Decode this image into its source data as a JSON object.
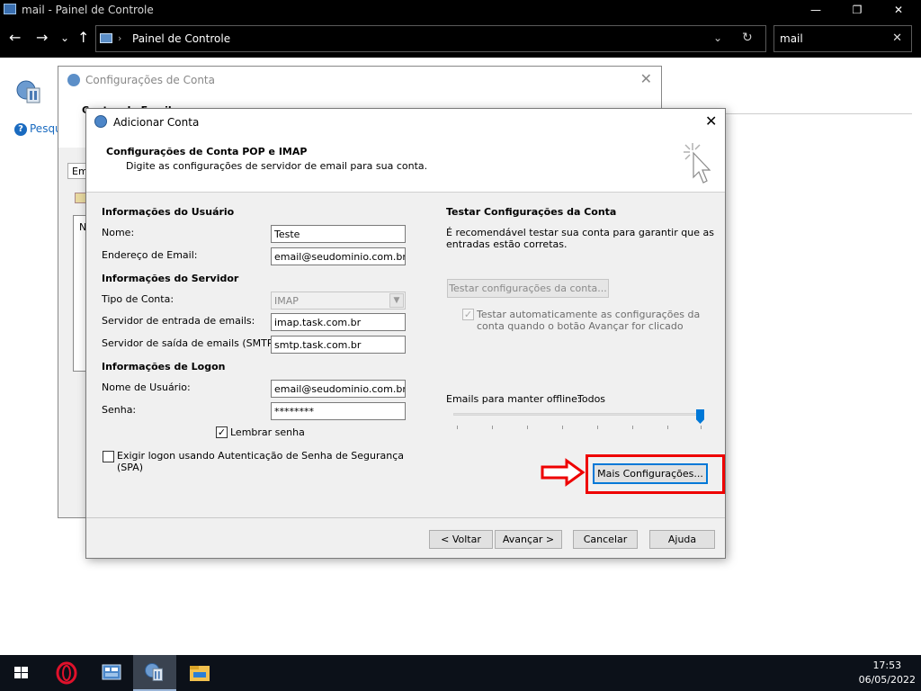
{
  "window": {
    "title": "mail - Painel de Controle",
    "minimize_glyph": "—",
    "maximize_glyph": "❐",
    "close_glyph": "✕"
  },
  "nav": {
    "back_glyph": "←",
    "forward_glyph": "→",
    "recent_glyph": "⌄",
    "up_glyph": "↑",
    "breadcrumb_sep": "›",
    "breadcrumb": "Painel de Controle",
    "address_dropdown_glyph": "⌄",
    "refresh_glyph": "↻",
    "search_value": "mail",
    "search_clear_glyph": "✕"
  },
  "background": {
    "help_glyph": "?",
    "help_text": "Pesqu",
    "config_dialog": {
      "title": "Configurações de Conta",
      "close_glyph": "✕",
      "subtitle": "Contas de Email",
      "tab_label": "Ema",
      "list_letter": "N"
    }
  },
  "dialog": {
    "title": "Adicionar Conta",
    "close_glyph": "✕",
    "header_title": "Configurações de Conta POP e IMAP",
    "header_desc": "Digite as configurações de servidor de email para sua conta.",
    "user_info": {
      "heading": "Informações do Usuário",
      "name_label": "Nome:",
      "name_value": "Teste",
      "email_label": "Endereço de Email:",
      "email_value": "email@seudominio.com.br"
    },
    "server_info": {
      "heading": "Informações do Servidor",
      "account_type_label": "Tipo de Conta:",
      "account_type_value": "IMAP",
      "incoming_label": "Servidor de entrada de emails:",
      "incoming_value": "imap.task.com.br",
      "outgoing_label": "Servidor de saída de emails (SMTP):",
      "outgoing_value": "smtp.task.com.br"
    },
    "logon_info": {
      "heading": "Informações de Logon",
      "username_label": "Nome de Usuário:",
      "username_value": "email@seudominio.com.br",
      "password_label": "Senha:",
      "password_value": "********",
      "remember_label": "Lembrar senha",
      "remember_checked": true,
      "spa_label_line1": "Exigir logon usando Autenticação de Senha de Segurança",
      "spa_label_line2": "(SPA)",
      "spa_checked": false
    },
    "test_settings": {
      "heading": "Testar Configurações da Conta",
      "desc_line1": "É recomendável testar sua conta para garantir que as",
      "desc_line2": "entradas estão corretas.",
      "test_button": "Testar configurações da conta...",
      "auto_test_label_line1": "Testar automaticamente as configurações da",
      "auto_test_label_line2": "conta quando o botão Avançar for clicado",
      "auto_test_checked": true
    },
    "offline": {
      "label": "Emails para manter offline:",
      "value": "Todos",
      "slider_position_fraction": 1.0
    },
    "more_settings_button": "Mais Configurações...",
    "buttons": {
      "back": "< Voltar",
      "next": "Avançar >",
      "cancel": "Cancelar",
      "help": "Ajuda"
    },
    "checkmark_glyph": "✓"
  },
  "taskbar": {
    "time": "17:53",
    "date": "06/05/2022"
  },
  "colors": {
    "highlight": "#e00000",
    "accent": "#0078d7",
    "taskbar": "#0c1119"
  }
}
